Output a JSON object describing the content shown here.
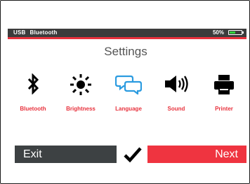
{
  "status": {
    "usb": "USB",
    "bluetooth": "Bluetooth",
    "battery_percent_text": "50%",
    "battery_level": 0.5,
    "battery_color": "#2fd43b"
  },
  "accent_color": "#e8323d",
  "title": "Settings",
  "items": [
    {
      "label": "Bluetooth",
      "icon": "bluetooth-icon"
    },
    {
      "label": "Brightness",
      "icon": "sun-icon"
    },
    {
      "label": "Language",
      "icon": "speech-bubbles-icon"
    },
    {
      "label": "Sound",
      "icon": "speaker-icon"
    },
    {
      "label": "Printer",
      "icon": "printer-icon"
    }
  ],
  "buttons": {
    "exit": "Exit",
    "next": "Next",
    "confirm_icon": "checkmark-icon"
  }
}
